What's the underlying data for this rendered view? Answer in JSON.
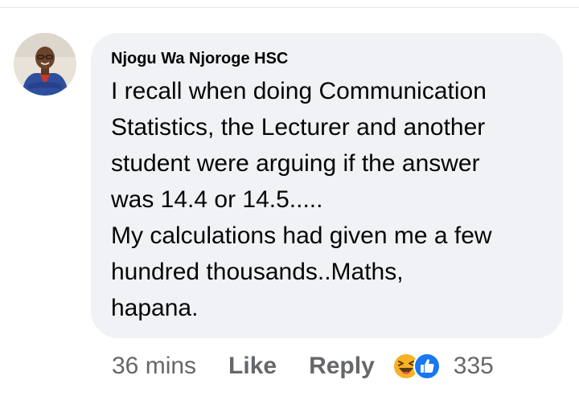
{
  "comment": {
    "author": "Njogu Wa Njoroge HSC",
    "text_lines": [
      "I recall when doing Communication",
      "Statistics, the Lecturer and another",
      "student were arguing if the answer",
      "was 14.4 or 14.5.....",
      "My calculations had given me a few",
      "hundred thousands..Maths,",
      "hapana."
    ],
    "timestamp": "36 mins",
    "like_label": "Like",
    "reply_label": "Reply",
    "reaction_count": "335",
    "reaction_icons": [
      "haha-icon",
      "like-icon"
    ]
  },
  "colors": {
    "bubble": "#f0f2f5",
    "text": "#050505",
    "meta": "#65676b",
    "like_blue": "#1877f2",
    "haha_yellow": "#f7b125"
  }
}
